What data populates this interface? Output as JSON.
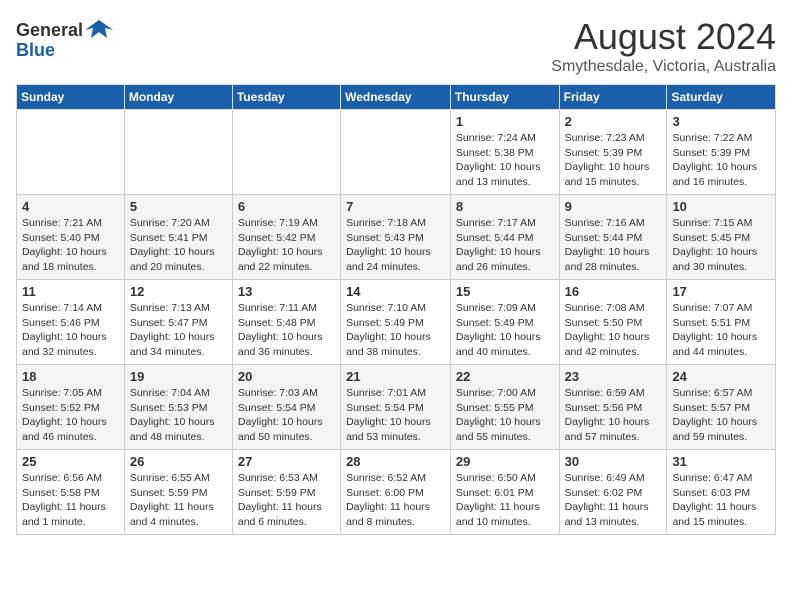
{
  "logo": {
    "text_general": "General",
    "text_blue": "Blue"
  },
  "title": "August 2024",
  "subtitle": "Smythesdale, Victoria, Australia",
  "days_of_week": [
    "Sunday",
    "Monday",
    "Tuesday",
    "Wednesday",
    "Thursday",
    "Friday",
    "Saturday"
  ],
  "weeks": [
    [
      {
        "day": "",
        "info": ""
      },
      {
        "day": "",
        "info": ""
      },
      {
        "day": "",
        "info": ""
      },
      {
        "day": "",
        "info": ""
      },
      {
        "day": "1",
        "info": "Sunrise: 7:24 AM\nSunset: 5:38 PM\nDaylight: 10 hours\nand 13 minutes."
      },
      {
        "day": "2",
        "info": "Sunrise: 7:23 AM\nSunset: 5:39 PM\nDaylight: 10 hours\nand 15 minutes."
      },
      {
        "day": "3",
        "info": "Sunrise: 7:22 AM\nSunset: 5:39 PM\nDaylight: 10 hours\nand 16 minutes."
      }
    ],
    [
      {
        "day": "4",
        "info": "Sunrise: 7:21 AM\nSunset: 5:40 PM\nDaylight: 10 hours\nand 18 minutes."
      },
      {
        "day": "5",
        "info": "Sunrise: 7:20 AM\nSunset: 5:41 PM\nDaylight: 10 hours\nand 20 minutes."
      },
      {
        "day": "6",
        "info": "Sunrise: 7:19 AM\nSunset: 5:42 PM\nDaylight: 10 hours\nand 22 minutes."
      },
      {
        "day": "7",
        "info": "Sunrise: 7:18 AM\nSunset: 5:43 PM\nDaylight: 10 hours\nand 24 minutes."
      },
      {
        "day": "8",
        "info": "Sunrise: 7:17 AM\nSunset: 5:44 PM\nDaylight: 10 hours\nand 26 minutes."
      },
      {
        "day": "9",
        "info": "Sunrise: 7:16 AM\nSunset: 5:44 PM\nDaylight: 10 hours\nand 28 minutes."
      },
      {
        "day": "10",
        "info": "Sunrise: 7:15 AM\nSunset: 5:45 PM\nDaylight: 10 hours\nand 30 minutes."
      }
    ],
    [
      {
        "day": "11",
        "info": "Sunrise: 7:14 AM\nSunset: 5:46 PM\nDaylight: 10 hours\nand 32 minutes."
      },
      {
        "day": "12",
        "info": "Sunrise: 7:13 AM\nSunset: 5:47 PM\nDaylight: 10 hours\nand 34 minutes."
      },
      {
        "day": "13",
        "info": "Sunrise: 7:11 AM\nSunset: 5:48 PM\nDaylight: 10 hours\nand 36 minutes."
      },
      {
        "day": "14",
        "info": "Sunrise: 7:10 AM\nSunset: 5:49 PM\nDaylight: 10 hours\nand 38 minutes."
      },
      {
        "day": "15",
        "info": "Sunrise: 7:09 AM\nSunset: 5:49 PM\nDaylight: 10 hours\nand 40 minutes."
      },
      {
        "day": "16",
        "info": "Sunrise: 7:08 AM\nSunset: 5:50 PM\nDaylight: 10 hours\nand 42 minutes."
      },
      {
        "day": "17",
        "info": "Sunrise: 7:07 AM\nSunset: 5:51 PM\nDaylight: 10 hours\nand 44 minutes."
      }
    ],
    [
      {
        "day": "18",
        "info": "Sunrise: 7:05 AM\nSunset: 5:52 PM\nDaylight: 10 hours\nand 46 minutes."
      },
      {
        "day": "19",
        "info": "Sunrise: 7:04 AM\nSunset: 5:53 PM\nDaylight: 10 hours\nand 48 minutes."
      },
      {
        "day": "20",
        "info": "Sunrise: 7:03 AM\nSunset: 5:54 PM\nDaylight: 10 hours\nand 50 minutes."
      },
      {
        "day": "21",
        "info": "Sunrise: 7:01 AM\nSunset: 5:54 PM\nDaylight: 10 hours\nand 53 minutes."
      },
      {
        "day": "22",
        "info": "Sunrise: 7:00 AM\nSunset: 5:55 PM\nDaylight: 10 hours\nand 55 minutes."
      },
      {
        "day": "23",
        "info": "Sunrise: 6:59 AM\nSunset: 5:56 PM\nDaylight: 10 hours\nand 57 minutes."
      },
      {
        "day": "24",
        "info": "Sunrise: 6:57 AM\nSunset: 5:57 PM\nDaylight: 10 hours\nand 59 minutes."
      }
    ],
    [
      {
        "day": "25",
        "info": "Sunrise: 6:56 AM\nSunset: 5:58 PM\nDaylight: 11 hours\nand 1 minute."
      },
      {
        "day": "26",
        "info": "Sunrise: 6:55 AM\nSunset: 5:59 PM\nDaylight: 11 hours\nand 4 minutes."
      },
      {
        "day": "27",
        "info": "Sunrise: 6:53 AM\nSunset: 5:59 PM\nDaylight: 11 hours\nand 6 minutes."
      },
      {
        "day": "28",
        "info": "Sunrise: 6:52 AM\nSunset: 6:00 PM\nDaylight: 11 hours\nand 8 minutes."
      },
      {
        "day": "29",
        "info": "Sunrise: 6:50 AM\nSunset: 6:01 PM\nDaylight: 11 hours\nand 10 minutes."
      },
      {
        "day": "30",
        "info": "Sunrise: 6:49 AM\nSunset: 6:02 PM\nDaylight: 11 hours\nand 13 minutes."
      },
      {
        "day": "31",
        "info": "Sunrise: 6:47 AM\nSunset: 6:03 PM\nDaylight: 11 hours\nand 15 minutes."
      }
    ]
  ]
}
